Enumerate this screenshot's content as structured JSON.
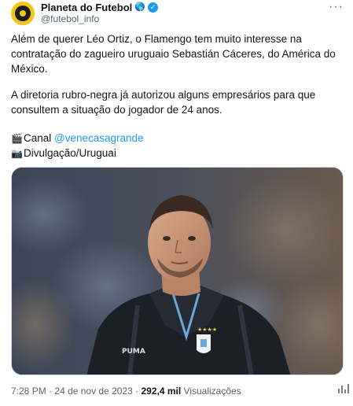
{
  "author": {
    "display_name": "Planeta do Futebol",
    "handle": "@futebol_info",
    "badges": [
      "globe-icon",
      "verified-icon"
    ],
    "avatar_color": "#f5c518"
  },
  "tweet": {
    "paragraph1_lines": [
      "Além de querer Léo Ortiz, o Flamengo tem muito interesse na",
      "contratação do zagueiro uruguaio Sebastián Cáceres, do América do",
      "México."
    ],
    "paragraph2_lines": [
      "A diretoria rubro-negra já autorizou alguns empresários para que",
      "consultem a situação do jogador de 24 anos."
    ],
    "credit1_prefix": "Canal ",
    "credit1_link": "@venecasagrande",
    "credit2": "Divulgação/Uruguai",
    "credit1_icon": "clapperboard-icon",
    "credit2_icon": "camera-icon"
  },
  "footer": {
    "time": "7:28 PM",
    "separator1": "·",
    "date": "24 de nov de 2023",
    "separator2": "·",
    "views_count": "292,4 mil",
    "views_label": "Visualizações"
  },
  "colors": {
    "link": "#1d9bf0",
    "verified": "#1d9bf0",
    "secondary_text": "#536471"
  }
}
